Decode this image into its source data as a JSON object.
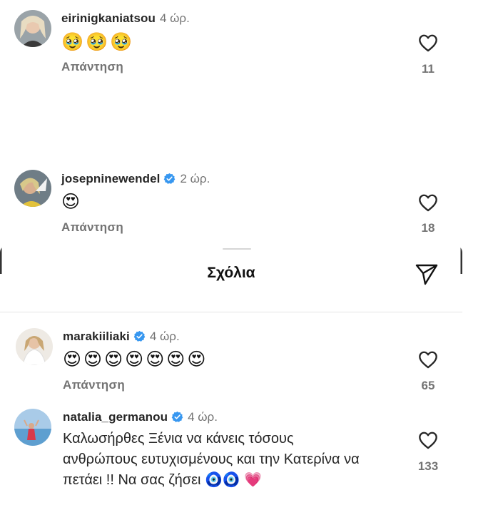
{
  "comments_top": [
    {
      "username": "eirinigkaniatsou",
      "verified": false,
      "time": "4 ώρ.",
      "emojis": "🥹🥹🥹",
      "reply": "Απάντηση",
      "likes": "11"
    },
    {
      "username": "josepninewendel",
      "verified": true,
      "time": "2 ώρ.",
      "emojis": "😍",
      "reply": "Απάντηση",
      "likes": "18"
    }
  ],
  "sheet": {
    "title": "Σχόλια"
  },
  "comments_sheet": [
    {
      "username": "marakiiliaki",
      "verified": true,
      "time": "4 ώρ.",
      "emojis": "😍😍😍😍😍😍😍",
      "reply": "Απάντηση",
      "likes": "65"
    },
    {
      "username": "natalia_germanou",
      "verified": true,
      "time": "4 ώρ.",
      "text": "Καλωσήρθες Ξένια να κάνεις τόσους ανθρώπους ευτυχισμένους και την Κατερίνα να πετάει !! Να σας ζήσει 🧿🧿 💗",
      "likes": "133"
    }
  ],
  "icons": {
    "like": "heart-outline-icon",
    "share": "paper-plane-icon",
    "verified": "verified-badge-icon"
  },
  "colors": {
    "verified_blue": "#3797f0",
    "secondary_text": "#737373"
  }
}
